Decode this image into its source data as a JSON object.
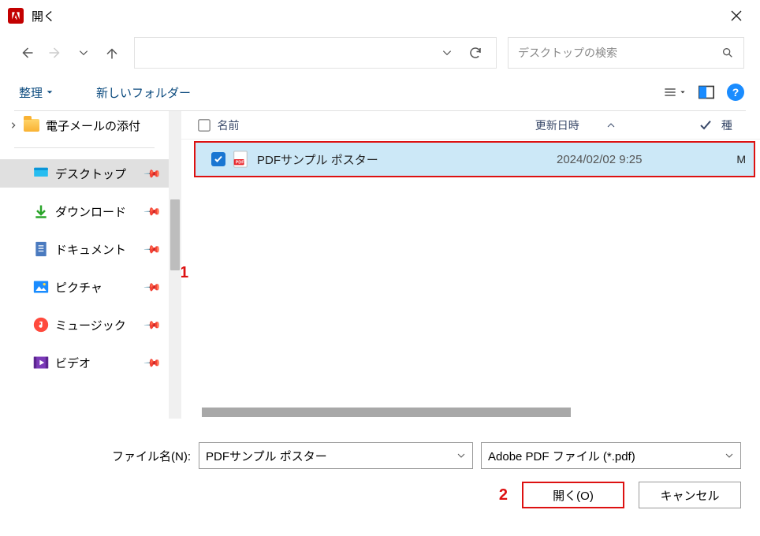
{
  "titlebar": {
    "title": "開く"
  },
  "search": {
    "placeholder": "デスクトップの検索"
  },
  "toolbar": {
    "organize": "整理",
    "newfolder": "新しいフォルダー"
  },
  "crumb": {
    "label": "電子メールの添付"
  },
  "sidebar": {
    "items": [
      {
        "label": "デスクトップ"
      },
      {
        "label": "ダウンロード"
      },
      {
        "label": "ドキュメント"
      },
      {
        "label": "ピクチャ"
      },
      {
        "label": "ミュージック"
      },
      {
        "label": "ビデオ"
      }
    ]
  },
  "columns": {
    "name": "名前",
    "date": "更新日時",
    "type": "種"
  },
  "files": [
    {
      "name": "PDFサンプル ポスター",
      "date": "2024/02/02 9:25",
      "type": "M"
    }
  ],
  "annotations": {
    "row": "1",
    "open": "2"
  },
  "bottom": {
    "filename_label": "ファイル名(N):",
    "filename_value": "PDFサンプル ポスター",
    "filter_value": "Adobe PDF ファイル (*.pdf)",
    "open": "開く(O)",
    "cancel": "キャンセル"
  }
}
